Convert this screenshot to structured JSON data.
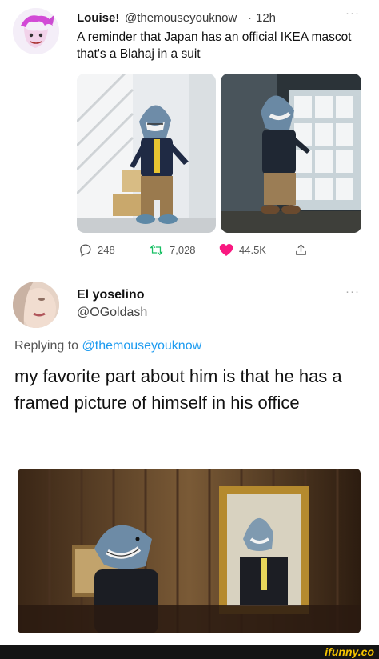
{
  "tweet1": {
    "name": "Louise!",
    "handle": "@themouseyouknow",
    "separator": "·",
    "time": "12h",
    "more": "···",
    "text": "A reminder that Japan has an official IKEA mascot that's a Blahaj in a suit",
    "stats": {
      "replies": "248",
      "retweets": "7,028",
      "likes": "44.5K"
    },
    "icons": [
      "reply-icon",
      "retweet-icon",
      "heart-icon",
      "share-icon"
    ],
    "colors": {
      "heart": "#f91880",
      "retweet": "#17bf63"
    }
  },
  "tweet2": {
    "name": "El yoselino",
    "handle": "@OGoldash",
    "more": "···",
    "replying_prefix": "Replying to",
    "replying_mention": "@themouseyouknow",
    "text": "my favorite part about him is that he has a framed picture of himself in his office",
    "colors": {
      "mention": "#1d9bf0"
    }
  },
  "watermark": {
    "logo": "ifunny.co",
    "colors": {
      "logo": "#f5c400",
      "bar": "#141414"
    }
  }
}
